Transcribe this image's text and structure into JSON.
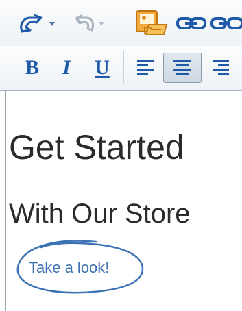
{
  "toolbar": {
    "row1": [
      {
        "name": "undo-button",
        "icon": "undo-icon",
        "has_dropdown": true
      },
      {
        "name": "redo-button",
        "icon": "redo-icon",
        "has_dropdown": true,
        "disabled": true
      },
      {
        "name": "image-manager-button",
        "icon": "image-folder-icon"
      },
      {
        "name": "link-button",
        "icon": "link-icon"
      },
      {
        "name": "unlink-button",
        "icon": "unlink-icon"
      }
    ],
    "row2": [
      {
        "name": "bold-button",
        "label": "B"
      },
      {
        "name": "italic-button",
        "label": "I"
      },
      {
        "name": "underline-button",
        "label": "U"
      },
      {
        "name": "align-left-button",
        "icon": "align-left-icon"
      },
      {
        "name": "align-center-button",
        "icon": "align-center-icon",
        "active": true
      },
      {
        "name": "align-right-button",
        "icon": "align-right-icon"
      }
    ]
  },
  "editor": {
    "heading": "Get Started",
    "subheading": "With Our Store",
    "cta_text": "Take a look!"
  },
  "colors": {
    "icon_blue": "#1e5aa8",
    "cta_blue": "#3c72b3",
    "text_dark": "#2b2b2b",
    "folder_orange": "#f0a030"
  }
}
